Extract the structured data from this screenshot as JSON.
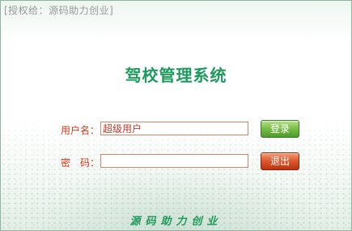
{
  "license_text": "[授权给：源码助力创业]",
  "title": "驾校管理系统",
  "form": {
    "username_label": "用户名：",
    "username_value": "超级用户",
    "password_label": "密　码：",
    "password_value": ""
  },
  "buttons": {
    "login": "登录",
    "exit": "退出"
  },
  "footer": "源码助力创业",
  "colors": {
    "title": "#1e9a5e",
    "label": "#d23a1a",
    "login_button": "#7cc04b",
    "exit_button": "#df5a2e"
  }
}
